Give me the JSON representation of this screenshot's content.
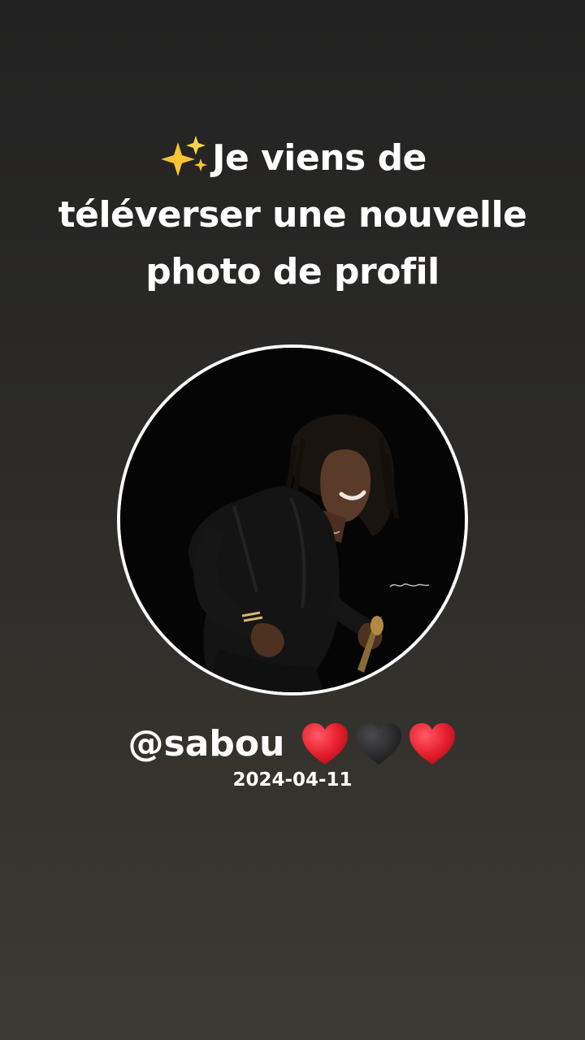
{
  "headline": {
    "line1": "Je viens de",
    "line2": "téléverser une nouvelle",
    "line3": "photo de profil",
    "icon": "sparkles-icon"
  },
  "profile": {
    "image": "profile-photo-singer-with-microphone",
    "handle": "@sabou",
    "hearts": [
      {
        "icon": "red-heart-icon",
        "color": "#e8202e"
      },
      {
        "icon": "black-heart-icon",
        "color": "#2e2e30"
      },
      {
        "icon": "red-heart-icon",
        "color": "#e8202e"
      }
    ],
    "date": "2024-04-11"
  },
  "colors": {
    "background_top": "#222222",
    "background_bottom": "#3d3a33",
    "text": "#ffffff",
    "ring": "#ffffff"
  }
}
